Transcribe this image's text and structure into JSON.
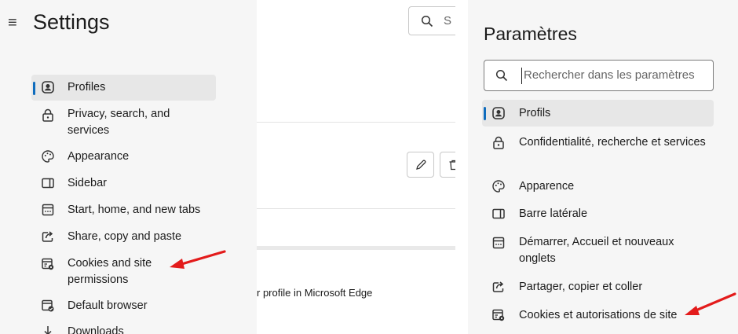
{
  "left": {
    "title": "Settings",
    "nav": [
      {
        "label": "Profiles",
        "icon": "profile-icon",
        "selected": true
      },
      {
        "label": "Privacy, search, and services",
        "icon": "lock-icon"
      },
      {
        "label": "Appearance",
        "icon": "palette-icon"
      },
      {
        "label": "Sidebar",
        "icon": "sidebar-icon"
      },
      {
        "label": "Start, home, and new tabs",
        "icon": "home-tabs-icon"
      },
      {
        "label": "Share, copy and paste",
        "icon": "share-icon"
      },
      {
        "label": "Cookies and site permissions",
        "icon": "cookies-permissions-icon"
      },
      {
        "label": "Default browser",
        "icon": "default-browser-icon"
      },
      {
        "label": "Downloads",
        "icon": "download-icon"
      }
    ]
  },
  "middle": {
    "search_placeholder": "S",
    "profile_text": "r profile in Microsoft Edge"
  },
  "right": {
    "title": "Paramètres",
    "search_placeholder": "Rechercher dans les paramètres",
    "nav": [
      {
        "label": "Profils",
        "icon": "profile-icon",
        "selected": true
      },
      {
        "label": "Confidentialité, recherche et services",
        "icon": "lock-icon"
      },
      {
        "label": "Apparence",
        "icon": "palette-icon"
      },
      {
        "label": "Barre latérale",
        "icon": "sidebar-icon"
      },
      {
        "label": "Démarrer, Accueil et nouveaux onglets",
        "icon": "home-tabs-icon"
      },
      {
        "label": "Partager, copier et coller",
        "icon": "share-icon"
      },
      {
        "label": "Cookies et autorisations de site",
        "icon": "cookies-permissions-icon"
      }
    ]
  },
  "colors": {
    "accent": "#0f6cbd",
    "annotation_arrow": "#e31b1b",
    "nav_background": "#f6f6f6",
    "selected_background": "#e7e7e7"
  }
}
